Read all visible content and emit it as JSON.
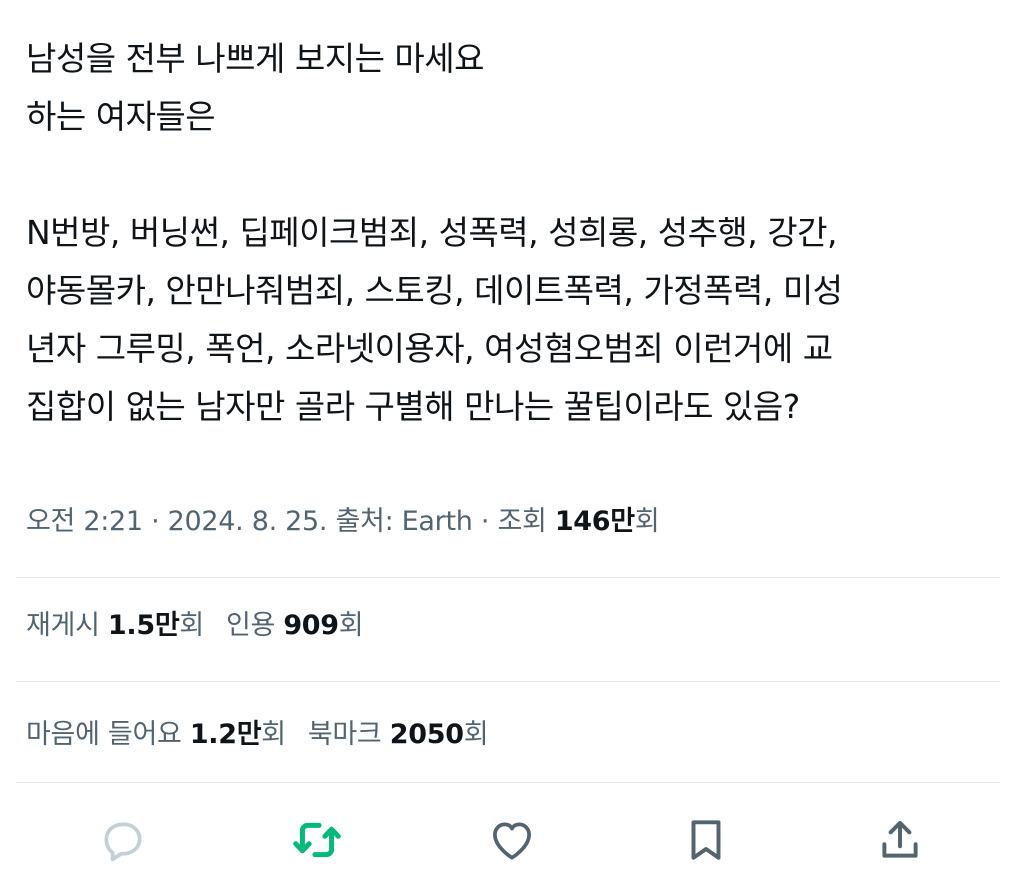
{
  "tweet": {
    "lines": [
      "남성을 전부 나쁘게 보지는 마세요",
      "하는 여자들은",
      "",
      "N번방, 버닝썬, 딥페이크범죄, 성폭력, 성희롱, 성추행, 강간,",
      "야동몰카, 안만나줘범죄, 스토킹, 데이트폭력, 가정폭력, 미성",
      "년자 그루밍, 폭언, 소라넷이용자, 여성혐오범죄 이런거에 교",
      "집합이 없는 남자만 골라 구별해 만나는 꿀팁이라도 있음?"
    ]
  },
  "meta": {
    "time": "오전 2:21",
    "sep1": " · ",
    "date": "2024. 8. 25.",
    "source": " 출처: Earth",
    "sep2": " · ",
    "views_label": "조회 ",
    "views_value": "146만",
    "views_suffix": "회"
  },
  "stats_row1": {
    "reposts_label": "재게시 ",
    "reposts_value": "1.5만",
    "reposts_suffix": "회",
    "quotes_label": "인용 ",
    "quotes_value": "909",
    "quotes_suffix": "회"
  },
  "stats_row2": {
    "likes_label": "마음에 들어요 ",
    "likes_value": "1.2만",
    "likes_suffix": "회",
    "bookmarks_label": "북마크 ",
    "bookmarks_value": "2050",
    "bookmarks_suffix": "회"
  },
  "actions": {
    "reply_icon": "reply-icon",
    "retweet_icon": "retweet-icon",
    "like_icon": "heart-icon",
    "bookmark_icon": "bookmark-icon",
    "share_icon": "share-icon"
  },
  "colors": {
    "text": "#0f1419",
    "muted": "#536471",
    "divider": "#e1e6ea",
    "retweet_active": "#00ba7c",
    "reply_disabled": "#c4cfd6"
  }
}
